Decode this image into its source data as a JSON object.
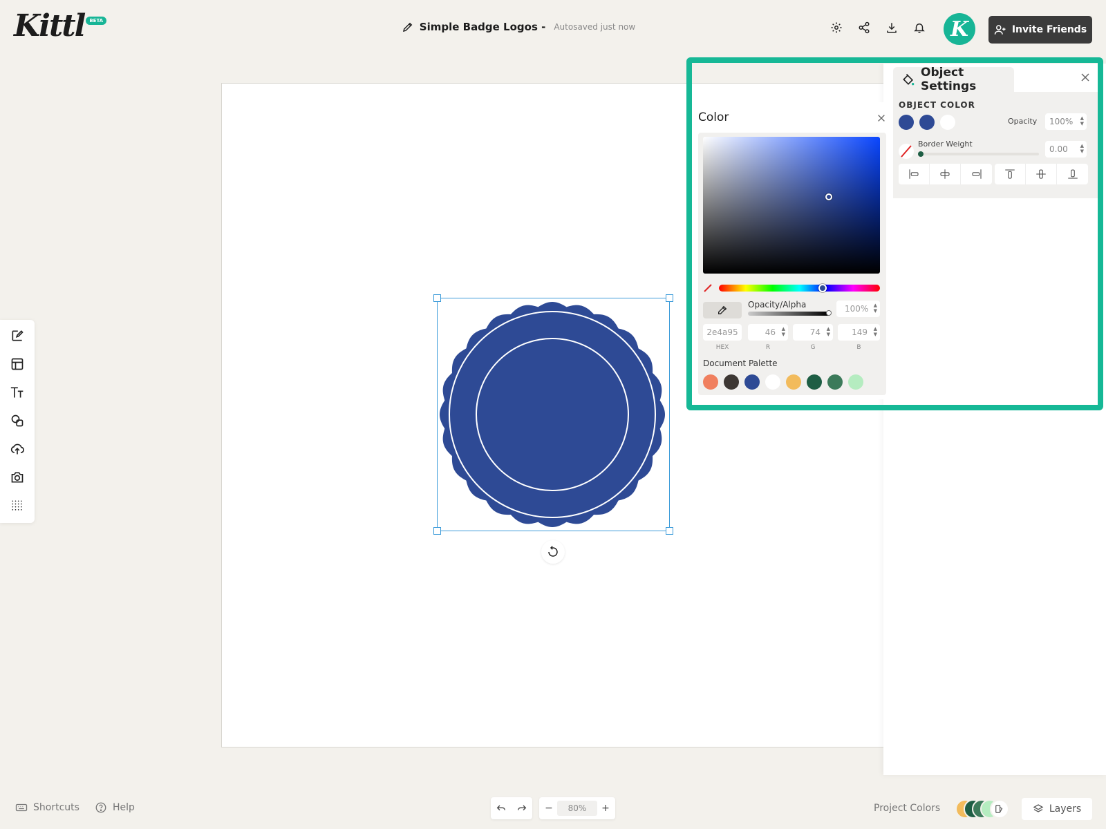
{
  "header": {
    "logo": "Kittl",
    "beta": "BETA",
    "doc_name": "Simple Badge Logos -",
    "save_status": "Autosaved just now",
    "invite_label": "Invite Friends",
    "avatar_letter": "K"
  },
  "object_settings": {
    "title": "Object Settings",
    "section": "OBJECT COLOR",
    "swatches": [
      "#2e4a95",
      "#2e4a95",
      "#ffffff"
    ],
    "opacity_label": "Opacity",
    "opacity_value": "100%",
    "border_label": "Border Weight",
    "border_value": "0.00",
    "border_weight": 0
  },
  "color_picker": {
    "title": "Color",
    "alpha_label": "Opacity/Alpha",
    "alpha_value": "100%",
    "hex": "2e4a95",
    "r": "46",
    "g": "74",
    "b": "149",
    "hex_cap": "HEX",
    "r_cap": "R",
    "g_cap": "G",
    "b_cap": "B",
    "palette_label": "Document Palette",
    "palette": [
      "#f07f5e",
      "#3d3733",
      "#2e4a95",
      "#ffffff",
      "#f2bb5c",
      "#1e5e44",
      "#3c7a5a",
      "#b5ecc0"
    ]
  },
  "badge": {
    "fill": "#2e4a95",
    "ring": "#ffffff"
  },
  "bottom": {
    "shortcuts": "Shortcuts",
    "help": "Help",
    "zoom": "80%",
    "project_colors": "Project Colors",
    "project_dots": [
      "#f2bb5c",
      "#1e5e44",
      "#3c7a5a",
      "#b5ecc0"
    ],
    "layers": "Layers"
  },
  "colors": {
    "accent": "#17b596",
    "highlight": "#16b896",
    "selection": "#3a9ad9"
  }
}
